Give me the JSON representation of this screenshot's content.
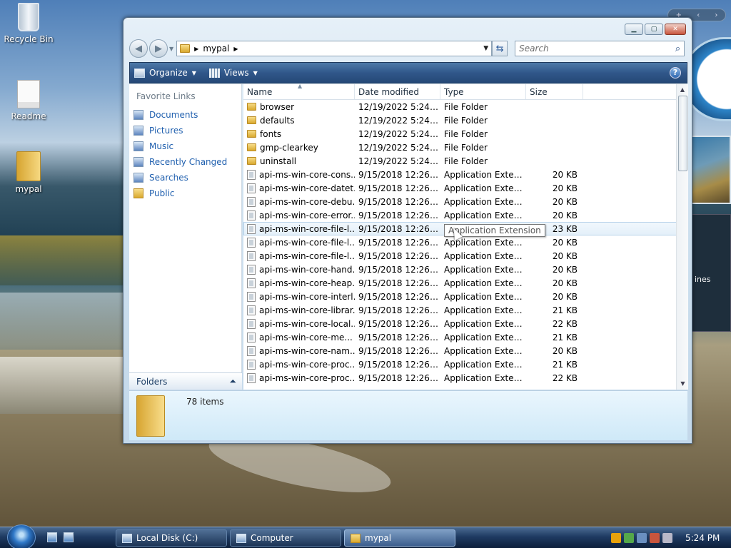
{
  "desktop": {
    "icons": [
      {
        "label": "Recycle Bin"
      },
      {
        "label": "Readme"
      },
      {
        "label": "mypal"
      }
    ],
    "gadget_text": "ines"
  },
  "window": {
    "path_folder": "mypal",
    "search_placeholder": "Search",
    "toolbar": {
      "organize": "Organize",
      "views": "Views",
      "help": "?"
    },
    "favorite_links_title": "Favorite Links",
    "favorites": [
      {
        "label": "Documents",
        "icon": "documents-icon"
      },
      {
        "label": "Pictures",
        "icon": "pictures-icon"
      },
      {
        "label": "Music",
        "icon": "music-icon"
      },
      {
        "label": "Recently Changed",
        "icon": "recent-icon"
      },
      {
        "label": "Searches",
        "icon": "searches-icon"
      },
      {
        "label": "Public",
        "icon": "public-folder-icon"
      }
    ],
    "folders_label": "Folders",
    "columns": {
      "name": "Name",
      "date": "Date modified",
      "type": "Type",
      "size": "Size"
    },
    "files": [
      {
        "name": "browser",
        "date": "12/19/2022 5:24 PM",
        "type": "File Folder",
        "size": "",
        "kind": "folder"
      },
      {
        "name": "defaults",
        "date": "12/19/2022 5:24 PM",
        "type": "File Folder",
        "size": "",
        "kind": "folder"
      },
      {
        "name": "fonts",
        "date": "12/19/2022 5:24 PM",
        "type": "File Folder",
        "size": "",
        "kind": "folder"
      },
      {
        "name": "gmp-clearkey",
        "date": "12/19/2022 5:24 PM",
        "type": "File Folder",
        "size": "",
        "kind": "folder"
      },
      {
        "name": "uninstall",
        "date": "12/19/2022 5:24 PM",
        "type": "File Folder",
        "size": "",
        "kind": "folder"
      },
      {
        "name": "api-ms-win-core-cons...",
        "date": "9/15/2018 12:26 AM",
        "type": "Application Extens...",
        "size": "20 KB",
        "kind": "dll"
      },
      {
        "name": "api-ms-win-core-datet...",
        "date": "9/15/2018 12:26 AM",
        "type": "Application Extens...",
        "size": "20 KB",
        "kind": "dll"
      },
      {
        "name": "api-ms-win-core-debu...",
        "date": "9/15/2018 12:26 AM",
        "type": "Application Extens...",
        "size": "20 KB",
        "kind": "dll"
      },
      {
        "name": "api-ms-win-core-error...",
        "date": "9/15/2018 12:26 AM",
        "type": "Application Extens...",
        "size": "20 KB",
        "kind": "dll"
      },
      {
        "name": "api-ms-win-core-file-l...",
        "date": "9/15/2018 12:26 AM",
        "type": "Application Extension",
        "size": "23 KB",
        "kind": "dll",
        "hover": true
      },
      {
        "name": "api-ms-win-core-file-l...",
        "date": "9/15/2018 12:26 AM",
        "type": "Application Extens...",
        "size": "20 KB",
        "kind": "dll"
      },
      {
        "name": "api-ms-win-core-file-l...",
        "date": "9/15/2018 12:26 AM",
        "type": "Application Extens...",
        "size": "20 KB",
        "kind": "dll"
      },
      {
        "name": "api-ms-win-core-hand...",
        "date": "9/15/2018 12:26 AM",
        "type": "Application Extens...",
        "size": "20 KB",
        "kind": "dll"
      },
      {
        "name": "api-ms-win-core-heap...",
        "date": "9/15/2018 12:26 AM",
        "type": "Application Extens...",
        "size": "20 KB",
        "kind": "dll"
      },
      {
        "name": "api-ms-win-core-interl...",
        "date": "9/15/2018 12:26 AM",
        "type": "Application Extens...",
        "size": "20 KB",
        "kind": "dll"
      },
      {
        "name": "api-ms-win-core-librar...",
        "date": "9/15/2018 12:26 AM",
        "type": "Application Extens...",
        "size": "21 KB",
        "kind": "dll"
      },
      {
        "name": "api-ms-win-core-local...",
        "date": "9/15/2018 12:26 AM",
        "type": "Application Extens...",
        "size": "22 KB",
        "kind": "dll"
      },
      {
        "name": "api-ms-win-core-me...",
        "date": "9/15/2018 12:26 AM",
        "type": "Application Extens...",
        "size": "21 KB",
        "kind": "dll"
      },
      {
        "name": "api-ms-win-core-nam...",
        "date": "9/15/2018 12:26 AM",
        "type": "Application Extens...",
        "size": "20 KB",
        "kind": "dll"
      },
      {
        "name": "api-ms-win-core-proc...",
        "date": "9/15/2018 12:26 AM",
        "type": "Application Extens...",
        "size": "21 KB",
        "kind": "dll"
      },
      {
        "name": "api-ms-win-core-proc...",
        "date": "9/15/2018 12:26 AM",
        "type": "Application Extens...",
        "size": "22 KB",
        "kind": "dll"
      }
    ],
    "tooltip": "Application Extension",
    "item_count": "78 items"
  },
  "taskbar": {
    "tasks": [
      {
        "label": "Local Disk (C:)"
      },
      {
        "label": "Computer"
      },
      {
        "label": "mypal"
      }
    ],
    "clock": "5:24 PM"
  }
}
